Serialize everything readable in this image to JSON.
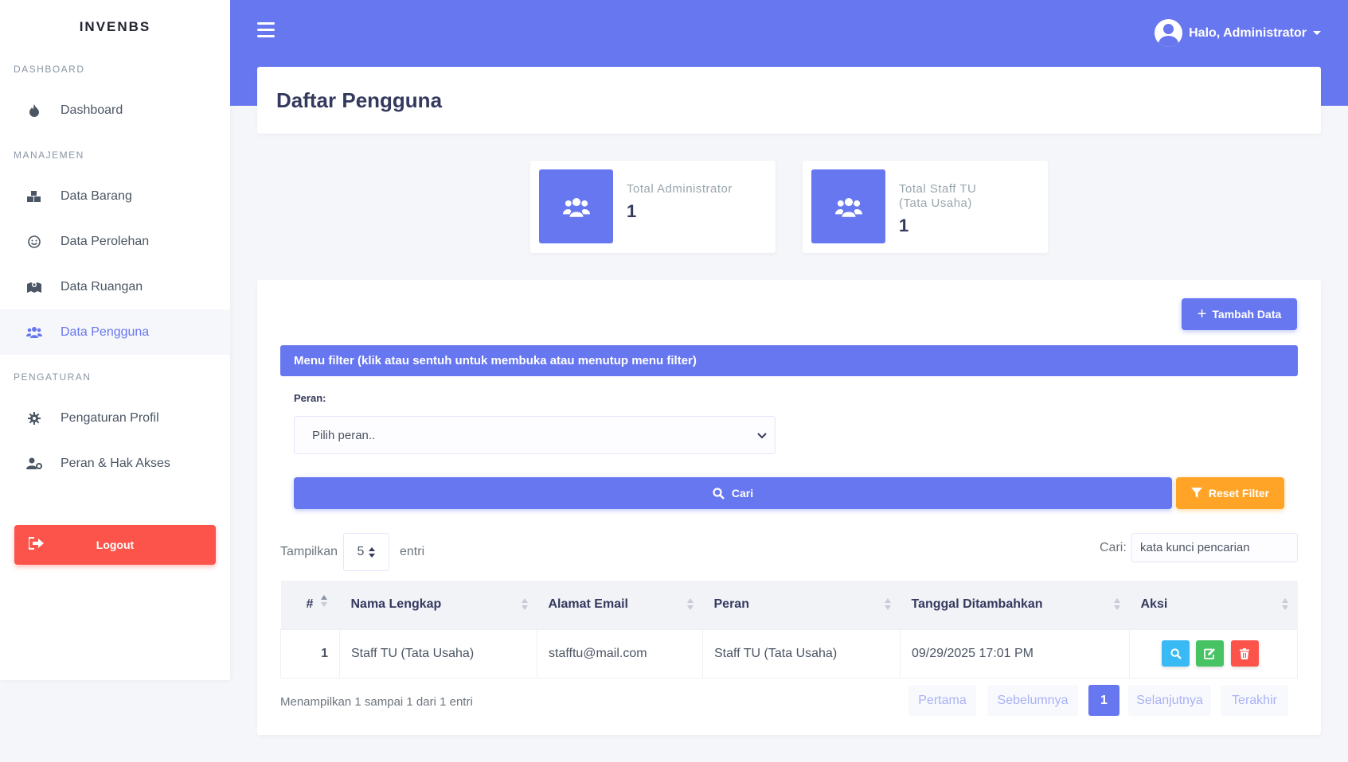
{
  "app": {
    "brand": "INVENBS"
  },
  "sidebar": {
    "sections": [
      {
        "title": "DASHBOARD"
      },
      {
        "title": "MANAJEMEN"
      },
      {
        "title": "PENGATURAN"
      }
    ],
    "items": [
      {
        "label": "Dashboard",
        "icon": "fire-icon"
      },
      {
        "label": "Data Barang",
        "icon": "boxes-icon"
      },
      {
        "label": "Data Perolehan",
        "icon": "smile-icon"
      },
      {
        "label": "Data Ruangan",
        "icon": "map-icon"
      },
      {
        "label": "Data Pengguna",
        "icon": "users-icon",
        "active": true
      },
      {
        "label": "Pengaturan Profil",
        "icon": "gear-icon"
      },
      {
        "label": "Peran & Hak Akses",
        "icon": "user-cog-icon"
      }
    ],
    "logout_label": "Logout"
  },
  "header": {
    "greeting": "Halo, Administrator"
  },
  "page": {
    "title": "Daftar Pengguna"
  },
  "stats": [
    {
      "label": "Total Administrator",
      "value": "1"
    },
    {
      "label": "Total Staff TU (Tata Usaha)",
      "value": "1"
    }
  ],
  "actions": {
    "add_label": "Tambah Data"
  },
  "filter": {
    "bar_label": "Menu filter (klik atau sentuh untuk membuka atau menutup menu filter)",
    "role_label": "Peran:",
    "role_placeholder": "Pilih peran..",
    "search_label": "Cari",
    "reset_label": "Reset Filter"
  },
  "table_controls": {
    "show_label": "Tampilkan",
    "page_length": "5",
    "entries_label": "entri",
    "search_label": "Cari:",
    "search_placeholder": "kata kunci pencarian"
  },
  "table": {
    "columns": [
      "#",
      "Nama Lengkap",
      "Alamat Email",
      "Peran",
      "Tanggal Ditambahkan",
      "Aksi"
    ],
    "rows": [
      {
        "no": "1",
        "name": "Staff TU (Tata Usaha)",
        "email": "stafftu@mail.com",
        "role": "Staff TU (Tata Usaha)",
        "date": "09/29/2025 17:01 PM"
      }
    ]
  },
  "pagination": {
    "info": "Menampilkan 1 sampai 1 dari 1 entri",
    "first": "Pertama",
    "prev": "Sebelumnya",
    "current": "1",
    "next": "Selanjutnya",
    "last": "Terakhir"
  },
  "colors": {
    "primary": "#6777ef",
    "danger": "#fc544b",
    "warning": "#ffa426",
    "info": "#3abaf4",
    "success": "#47c363"
  }
}
